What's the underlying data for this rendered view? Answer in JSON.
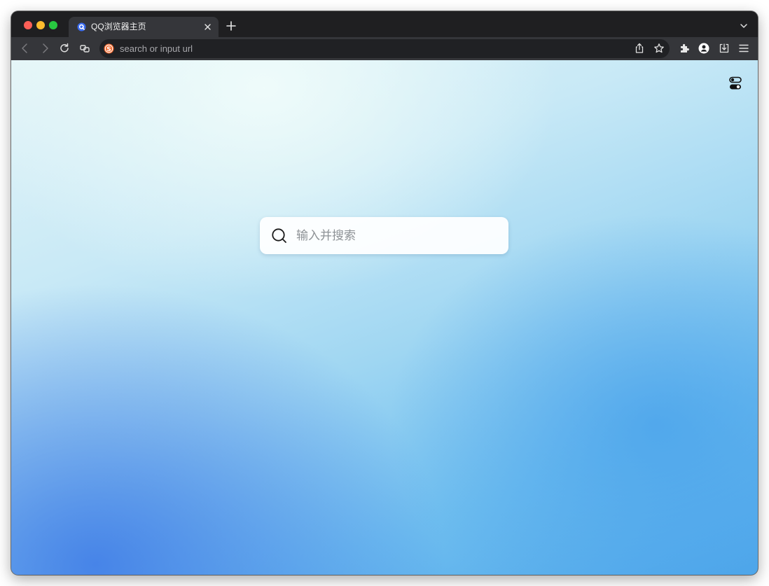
{
  "browser": {
    "tab": {
      "title": "QQ浏览器主页",
      "favicon": "qq-browser-icon"
    },
    "toolbar": {
      "omnibox_placeholder": "search or input url",
      "search_engine_icon": "sogou-icon"
    },
    "colors": {
      "tabstrip": "#1f1f21",
      "toolbar": "#35363a",
      "omnibox": "#202124",
      "accent_blue": "#4ea6ea"
    }
  },
  "page": {
    "search": {
      "placeholder": "输入并搜索",
      "icon": "search-icon"
    },
    "mode_toggle_icon": "toggle-icon"
  }
}
